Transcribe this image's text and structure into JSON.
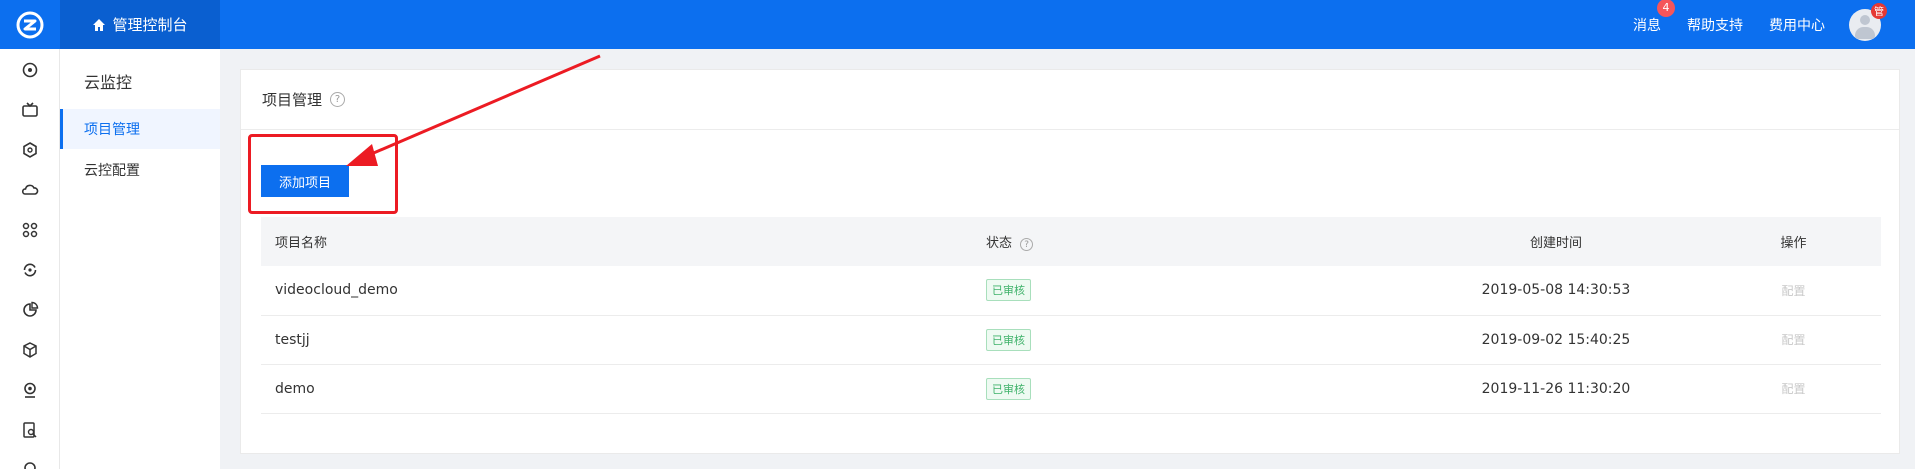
{
  "header": {
    "console_label": "管理控制台",
    "links": [
      "消息",
      "帮助支持",
      "费用中心"
    ],
    "message_badge": "4",
    "avatar_badge": "管",
    "bg_color": "#0c6fef"
  },
  "icon_rail": [
    "dashboard-icon",
    "tv-icon",
    "hexagon-icon",
    "cloud-icon",
    "network-icon",
    "refresh-icon",
    "pie-chart-icon",
    "cube-icon",
    "webcam-icon",
    "doc-search-icon",
    "more-icon"
  ],
  "sidebar": {
    "title": "云监控",
    "items": [
      {
        "label": "项目管理",
        "active": true
      },
      {
        "label": "云控配置",
        "active": false
      }
    ]
  },
  "main": {
    "title": "项目管理",
    "add_button": "添加项目",
    "columns": [
      "项目名称",
      "状态",
      "创建时间",
      "操作"
    ],
    "rows": [
      {
        "name": "videocloud_demo",
        "status": "已审核",
        "created": "2019-05-08 14:30:53",
        "action": "配置"
      },
      {
        "name": "testjj",
        "status": "已审核",
        "created": "2019-09-02 15:40:25",
        "action": "配置"
      },
      {
        "name": "demo",
        "status": "已审核",
        "created": "2019-11-26 11:30:20",
        "action": "配置"
      }
    ]
  }
}
